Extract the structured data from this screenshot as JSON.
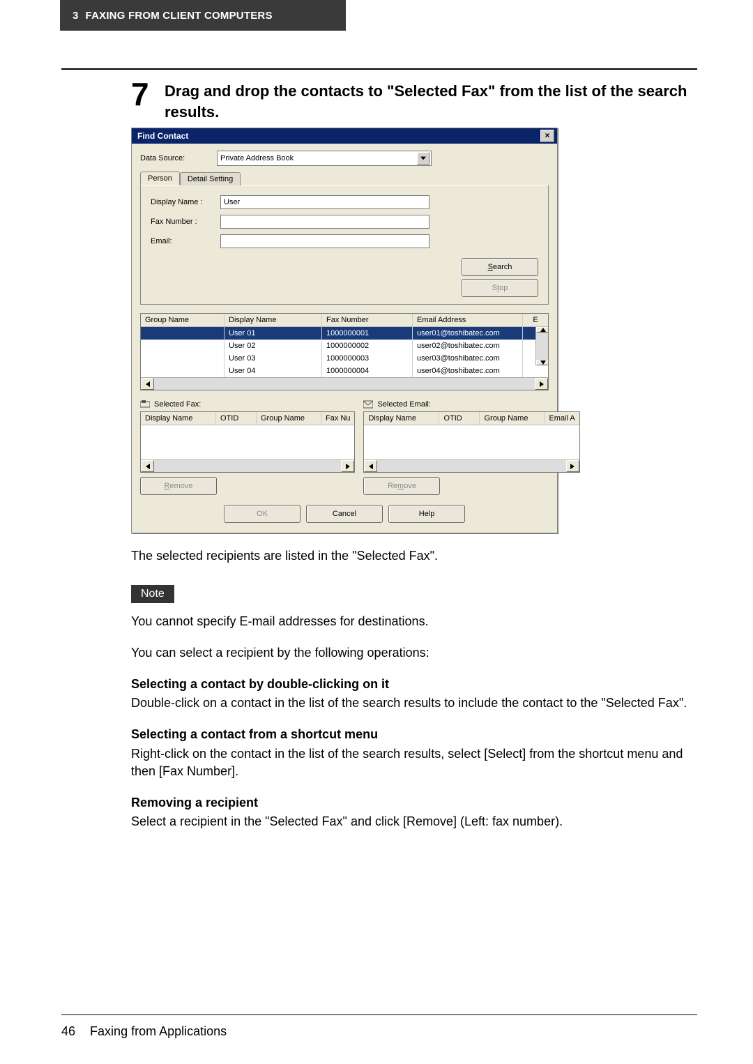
{
  "header": {
    "chapter_num": "3",
    "chapter_title": "FAXING FROM CLIENT COMPUTERS"
  },
  "step": {
    "number": "7",
    "text": "Drag and drop the contacts to \"Selected Fax\" from the list of the search results."
  },
  "dialog": {
    "title": "Find Contact",
    "data_source_label": "Data Source:",
    "data_source_value": "Private Address Book",
    "tabs": {
      "person": "Person",
      "detail": "Detail Setting"
    },
    "fields": {
      "display_name_label": "Display Name :",
      "display_name_value": "User",
      "fax_label": "Fax Number :",
      "fax_value": "",
      "email_label": "Email:",
      "email_value": ""
    },
    "buttons": {
      "search": "Search",
      "stop": "Stop",
      "remove": "Remove",
      "ok": "OK",
      "cancel": "Cancel",
      "help": "Help"
    },
    "results": {
      "headers": {
        "group": "Group Name",
        "display": "Display Name",
        "fax": "Fax Number",
        "email": "Email Address",
        "extra": "E"
      },
      "rows": [
        {
          "group": "",
          "display": "User 01",
          "fax": "1000000001",
          "email": "user01@toshibatec.com"
        },
        {
          "group": "",
          "display": "User 02",
          "fax": "1000000002",
          "email": "user02@toshibatec.com"
        },
        {
          "group": "",
          "display": "User 03",
          "fax": "1000000003",
          "email": "user03@toshibatec.com"
        },
        {
          "group": "",
          "display": "User 04",
          "fax": "1000000004",
          "email": "user04@toshibatec.com"
        }
      ]
    },
    "selected_fax": {
      "title": "Selected Fax:",
      "headers": [
        "Display Name",
        "OTID",
        "Group Name",
        "Fax Nu"
      ]
    },
    "selected_email": {
      "title": "Selected Email:",
      "headers": [
        "Display Name",
        "OTID",
        "Group Name",
        "Email A"
      ]
    }
  },
  "narrative": {
    "after_dialog": "The selected recipients are listed in the \"Selected Fax\".",
    "note_label": "Note",
    "note_line1": "You cannot specify E-mail addresses for destinations.",
    "line2": "You can select a recipient by the following operations:",
    "h1": "Selecting a contact by double-clicking on it",
    "p1": "Double-click on a contact in the list of the search results to include the contact to the \"Selected Fax\".",
    "h2": "Selecting a contact from a shortcut menu",
    "p2": "Right-click on the contact in the list of the search results, select [Select] from the shortcut menu and then [Fax Number].",
    "h3": "Removing a recipient",
    "p3": "Select a recipient in the \"Selected Fax\" and click [Remove] (Left: fax number)."
  },
  "footer": {
    "page": "46",
    "section": "Faxing from Applications"
  }
}
